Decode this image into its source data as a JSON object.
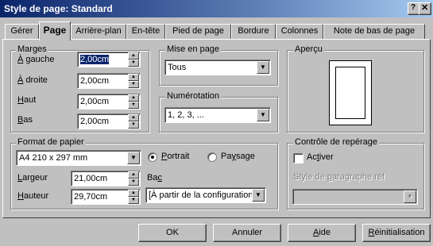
{
  "window": {
    "title": "Style de page: Standard"
  },
  "tabs": [
    "Gérer",
    "Page",
    "Arrière-plan",
    "En-tête",
    "Pied de page",
    "Bordure",
    "Colonnes",
    "Note de bas de page"
  ],
  "margins": {
    "title": "Marges",
    "left_label_u": "À",
    "left_label_rest": " gauche",
    "left_value": "2,00cm",
    "right_label_u": "À",
    "right_label_rest": " droite",
    "right_value": "2,00cm",
    "top_label_u": "H",
    "top_label_rest": "aut",
    "top_value": "2,00cm",
    "bottom_label_u": "B",
    "bottom_label_rest": "as",
    "bottom_value": "2,00cm"
  },
  "layout": {
    "title": "Mise en page",
    "value": "Tous"
  },
  "numbering": {
    "title": "Numérotation",
    "value": "1, 2, 3, ..."
  },
  "preview": {
    "title": "Aperçu"
  },
  "paper": {
    "title": "Format de papier",
    "format_value": "A4 210 x 297 mm",
    "portrait_u": "P",
    "portrait_rest": "ortrait",
    "landscape_pre": "Pa",
    "landscape_u": "y",
    "landscape_rest": "sage",
    "width_label_u": "L",
    "width_label_rest": "argeur",
    "width_value": "21,00cm",
    "height_label_u": "H",
    "height_label_rest": "auteur",
    "height_value": "29,70cm",
    "tray_label_pre": "Ba",
    "tray_label_u": "c",
    "tray_value": "[À partir de la configuration"
  },
  "register": {
    "title": "Contrôle de repérage",
    "activate_pre": "Ac",
    "activate_u": "t",
    "activate_rest": "iver",
    "style_pre": "Style de ",
    "style_u": "p",
    "style_rest": "aragraphe réf"
  },
  "buttons": {
    "ok": "OK",
    "cancel": "Annuler",
    "help_u": "A",
    "help_rest": "ide",
    "reset_u": "R",
    "reset_rest": "éinitialisation"
  }
}
